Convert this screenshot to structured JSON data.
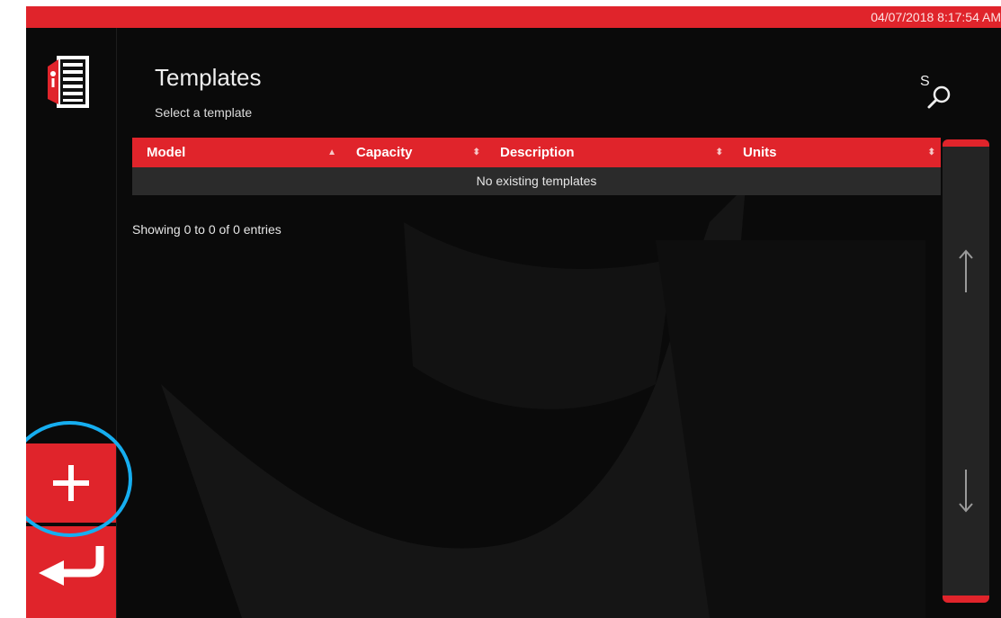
{
  "status_bar": {
    "datetime": "04/07/2018 8:17:54 AM"
  },
  "header": {
    "title": "Templates",
    "subtitle": "Select a template",
    "search_letter": "S"
  },
  "table": {
    "columns": [
      {
        "label": "Model",
        "sort_icon": "▲"
      },
      {
        "label": "Capacity",
        "sort_icon": "⬍"
      },
      {
        "label": "Description",
        "sort_icon": "⬍"
      },
      {
        "label": "Units",
        "sort_icon": "⬍"
      }
    ],
    "empty_message": "No existing templates",
    "info": "Showing 0 to 0 of 0 entries"
  },
  "icons": {
    "app": "template-document-icon",
    "search": "search-icon",
    "add": "plus-icon",
    "back": "return-arrow-icon",
    "scroll_up": "arrow-up-icon",
    "scroll_down": "arrow-down-icon"
  },
  "colors": {
    "accent": "#e0242b",
    "background": "#0a0a0a",
    "highlight": "#16aef0"
  }
}
